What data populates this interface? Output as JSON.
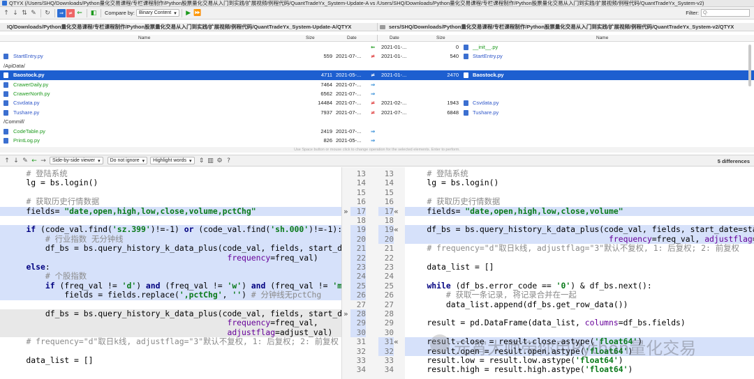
{
  "window": {
    "title": "QTYX (/Users/SHQ/Downloads/Python量化交易课程/专栏课程制作/Python股票量化交易从入门到实践/扩展视频/例程代码/QuantTradeYx_System-Update-A vs /Users/SHQ/Downloads/Python量化交易课程/专栏课程制作/Python股票量化交易从入门到实践/扩展视频/例程代码/QuantTradeYx_System-v2)"
  },
  "toolbar": {
    "compare_label": "Compare by:",
    "compare_value": "Binary Content",
    "filter_label": "Filter:",
    "filter_placeholder": "Q·"
  },
  "left_path": "IQ/Downloads/Python量化交易课程/专栏课程制作/Python股票量化交易从入门到实践/扩展视频/例程代码/QuantTradeYx_System-Update-A/QTYX",
  "right_path": "sers/SHQ/Downloads/Python量化交易课程/专栏课程制作/Python股票量化交易从入门到实践/扩展视频/例程代码/QuantTradeYx_System-v2/QTYX",
  "columns": {
    "left": [
      "Name",
      "Size",
      "Date"
    ],
    "right": [
      "Date",
      "Size",
      "Name"
    ]
  },
  "files": [
    {
      "ln": "",
      "ls": "",
      "ld": "",
      "op": "⇐",
      "rd": "2021-01-...",
      "rs": "0",
      "rn": "__init__.py",
      "cls": "g",
      "sel": false
    },
    {
      "ln": "StartEntry.py",
      "ls": "559",
      "ld": "2021-07-...",
      "op": "≠",
      "rd": "2021-01-...",
      "rs": "540",
      "rn": "StartEntry.py",
      "cls": "",
      "sel": false
    },
    {
      "ln": "/ApiData/",
      "ls": "",
      "ld": "",
      "op": "",
      "rd": "",
      "rs": "",
      "rn": "",
      "cls": "k",
      "sel": false
    },
    {
      "ln": "Baostock.py",
      "ls": "4711",
      "ld": "2021-05-...",
      "op": "≠",
      "rd": "2021-01-...",
      "rs": "2470",
      "rn": "Baostock.py",
      "cls": "",
      "sel": true
    },
    {
      "ln": "CrawerDaily.py",
      "ls": "7464",
      "ld": "2021-07-...",
      "op": "⇒",
      "rd": "",
      "rs": "",
      "rn": "",
      "cls": "g",
      "sel": false
    },
    {
      "ln": "CrawerNorth.py",
      "ls": "6562",
      "ld": "2021-07-...",
      "op": "⇒",
      "rd": "",
      "rs": "",
      "rn": "",
      "cls": "g",
      "sel": false
    },
    {
      "ln": "Csvdata.py",
      "ls": "14484",
      "ld": "2021-07-...",
      "op": "≠",
      "rd": "2021-02-...",
      "rs": "1943",
      "rn": "Csvdata.py",
      "cls": "",
      "sel": false
    },
    {
      "ln": "Tushare.py",
      "ls": "7937",
      "ld": "2021-07-...",
      "op": "≠",
      "rd": "2021-07-...",
      "rs": "6848",
      "rn": "Tushare.py",
      "cls": "",
      "sel": false
    },
    {
      "ln": "/Commif/",
      "ls": "",
      "ld": "",
      "op": "",
      "rd": "",
      "rs": "",
      "rn": "",
      "cls": "k",
      "sel": false
    },
    {
      "ln": "CodeTable.py",
      "ls": "2419",
      "ld": "2021-07-...",
      "op": "⇒",
      "rd": "",
      "rs": "",
      "rn": "",
      "cls": "g",
      "sel": false
    },
    {
      "ln": "PrintLog.py",
      "ls": "826",
      "ld": "2021-05-...",
      "op": "⇒",
      "rd": "",
      "rs": "",
      "rn": "",
      "cls": "g",
      "sel": false
    }
  ],
  "hint": "Use Space button or mouse click to change operation for the selected elements. Enter to perform.",
  "diff_toolbar": {
    "viewer": "Side-by-side viewer",
    "ignore": "Do not ignore",
    "highlight": "Highlight words",
    "count": "5 differences"
  },
  "gutter_left": [
    "13",
    "14",
    "15",
    "16",
    "17",
    "18",
    "19",
    "20",
    "21",
    "22",
    "23",
    "24",
    "25",
    "26",
    "27",
    "28",
    "29",
    "30",
    "31",
    "32",
    "33",
    "34"
  ],
  "gutter_right": [
    "13",
    "14",
    "15",
    "16",
    "17",
    "",
    "18",
    "19",
    "20",
    "21",
    "22",
    "23",
    "24",
    "25",
    "26",
    "27",
    "28",
    "29",
    "30",
    "31",
    "32",
    "33",
    "34"
  ],
  "left_code": [
    "    # 登陆系统",
    "    lg = bs.login()",
    "",
    "    # 获取历史行情数据",
    "    fields= \"date,open,high,low,close,volume,pctChg\"",
    "",
    "    if (code_val.find('sz.399')!=-1) or (code_val.find('sh.000')!=-1):",
    "        # 行业指数 无分钟线",
    "        df_bs = bs.query_history_k_data_plus(code_val, fields, start_da",
    "                                              frequency=freq_val)",
    "    else:",
    "        # 个股指数",
    "        if (freq_val != 'd') and (freq_val != 'w') and (freq_val != 'm'",
    "            fields = fields.replace(',pctChg', '') # 分钟线无pctChg",
    "",
    "        df_bs = bs.query_history_k_data_plus(code_val, fields, start_da",
    "                                              frequency=freq_val,",
    "                                              adjustflag=adjust_val)  #",
    "    # frequency=\"d\"取日k线, adjustflag=\"3\"默认不复权, 1: 后复权; 2: 前复权",
    "",
    "    data_list = []"
  ],
  "right_code": [
    "    # 登陆系统",
    "    lg = bs.login()",
    "",
    "    # 获取历史行情数据",
    "    fields= \"date,open,high,low,close,volume\"",
    "",
    "    df_bs = bs.query_history_k_data_plus(code_val, fields, start_date=sta",
    "                                          frequency=freq_val, adjustflag=adjust_va",
    "    # frequency=\"d\"取日k线, adjustflag=\"3\"默认不复权, 1: 后复权; 2: 前复权",
    "",
    "    data_list = []",
    "",
    "    while (df_bs.error_code == '0') & df_bs.next():",
    "        # 获取一条记录, 将记录合并在一起",
    "        data_list.append(df_bs.get_row_data())",
    "",
    "    result = pd.DataFrame(data_list, columns=df_bs.fields)",
    "",
    "    result.close = result.close.astype('float64')",
    "    result.open = result.open.astype('float64')",
    "    result.low = result.low.astype('float64')",
    "    result.high = result.high.astype('float64')"
  ],
  "watermark": "元宵大师带你用Python量化交易"
}
